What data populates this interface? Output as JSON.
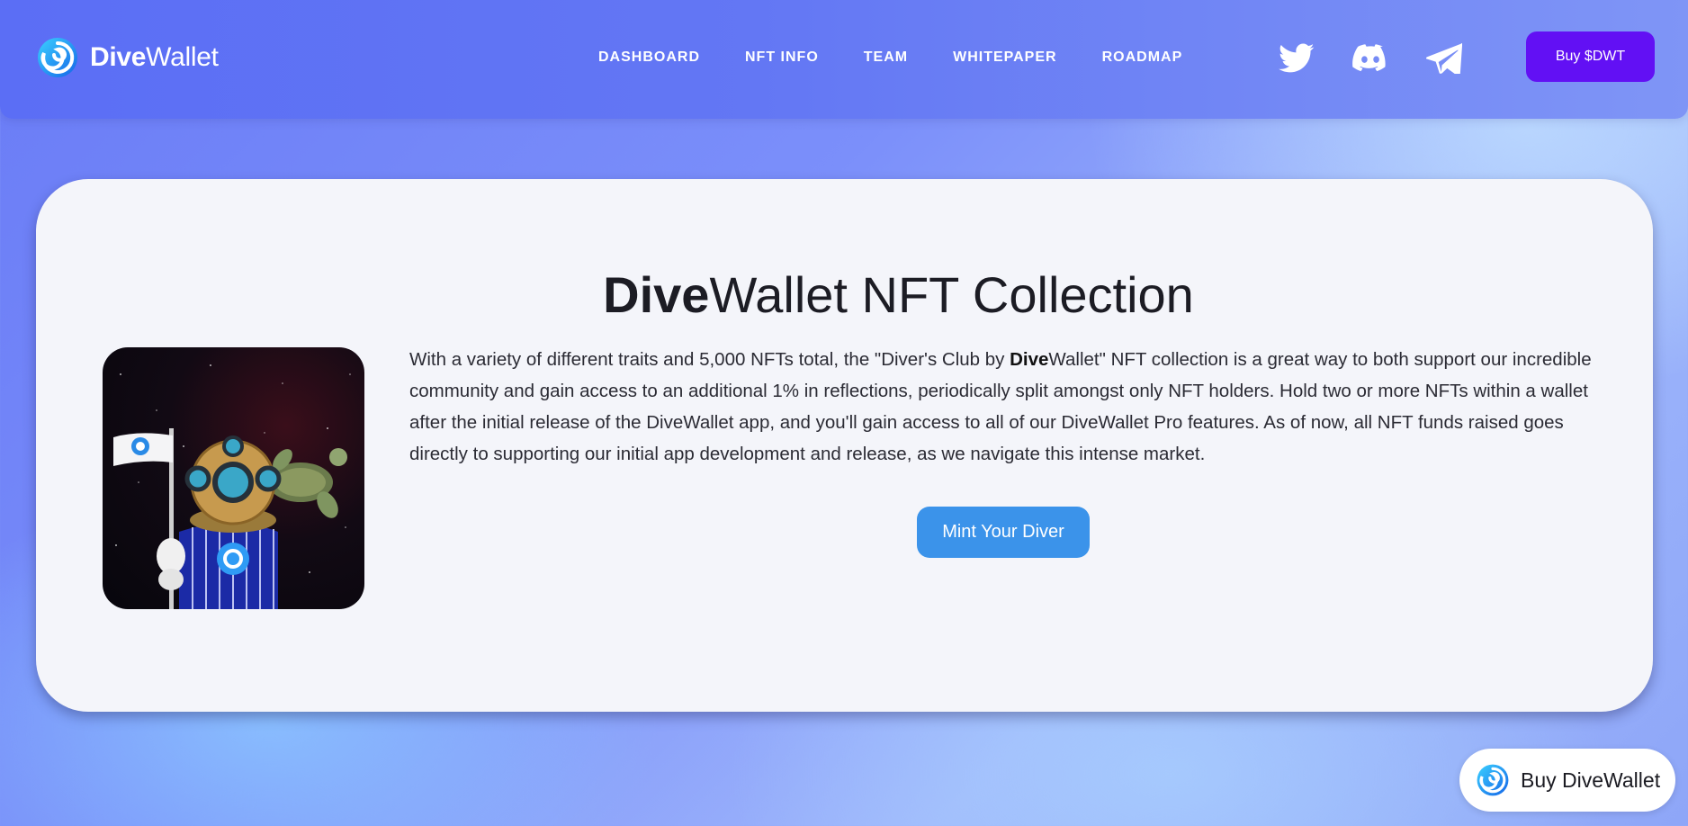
{
  "brand": {
    "name_bold": "Dive",
    "name_rest": "Wallet"
  },
  "nav": {
    "items": [
      "DASHBOARD",
      "NFT INFO",
      "TEAM",
      "WHITEPAPER",
      "ROADMAP"
    ]
  },
  "socials": [
    "twitter-icon",
    "discord-icon",
    "telegram-icon"
  ],
  "header": {
    "buy_label": "Buy $DWT"
  },
  "collection": {
    "title_bold": "Dive",
    "title_rest": "Wallet NFT Collection",
    "desc_part1": "With a variety of different traits and 5,000 NFTs total, the \"Diver's Club by ",
    "desc_bold": "Dive",
    "desc_part2": "Wallet\" NFT collection is a great way to both support our incredible community and gain access to an additional 1% in reflections, periodically split amongst only NFT holders. Hold two or more NFTs within a wallet after the initial release of the DiveWallet app, and you'll gain access to all of our DiveWallet Pro features. As of now, all NFT funds raised goes directly to supporting our initial app development and release, as we navigate this intense market.",
    "mint_label": "Mint Your Diver"
  },
  "floating": {
    "buy_label": "Buy DiveWallet"
  },
  "colors": {
    "accent": "#6210f4",
    "mint": "#3b93ea",
    "nav": "#5b6ef5",
    "card": "#f4f5fa"
  }
}
